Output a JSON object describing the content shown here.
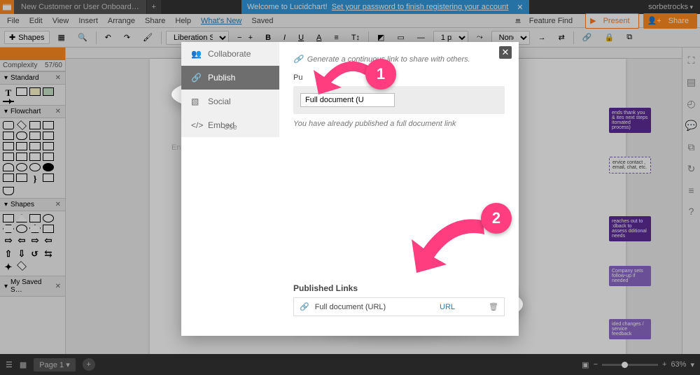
{
  "tabbar": {
    "doc_title": "New Customer or User Onboard…",
    "user": "sorbetrocks"
  },
  "banner": {
    "text": "Welcome to Lucidchart!",
    "link": "Set your password to finish registering your account"
  },
  "menubar": {
    "items": [
      "File",
      "Edit",
      "View",
      "Insert",
      "Arrange",
      "Share",
      "Help"
    ],
    "whats_new": "What's New",
    "saved": "Saved",
    "feature_find": "Feature Find",
    "present": "Present",
    "share": "Share"
  },
  "toolbar": {
    "shapes_btn": "Shapes",
    "font": "Liberation Sans",
    "stroke_width": "1 px",
    "line_style": "None"
  },
  "left": {
    "complexity_label": "Complexity",
    "complexity_value": "57/60",
    "sections": [
      "Standard",
      "Flowchart",
      "Shapes",
      "My Saved S…"
    ]
  },
  "status": {
    "page": "Page 1",
    "zoom": "63%"
  },
  "rightbar_icons": [
    "expand",
    "page",
    "clock",
    "comment",
    "layers",
    "history",
    "data",
    "question"
  ],
  "modal": {
    "tabs": {
      "collaborate": "Collaborate",
      "publish": "Publish",
      "social": "Social",
      "embed": "Embed"
    },
    "embed_abbrev": "En",
    "blurb": "Generate a continuous link to share with others.",
    "pub_label": "Pu",
    "select_value": "Full document (U",
    "already_text": "You have already published a full document link",
    "published_links_head": "Published Links",
    "row_label": "Full document (URL)",
    "row_url": "URL",
    "user_hint": "Use"
  },
  "canvas_cards": {
    "c1": "ends thank you & ites next steps itomated process)",
    "c2": "ervice contact , email, chat, etc.",
    "c3": "reaches out to :dback to assess dditional needs",
    "c4": "Company sets follow-up if needed",
    "c5": "ided changes / service feedback"
  },
  "badges": {
    "one": "1",
    "two": "2"
  }
}
